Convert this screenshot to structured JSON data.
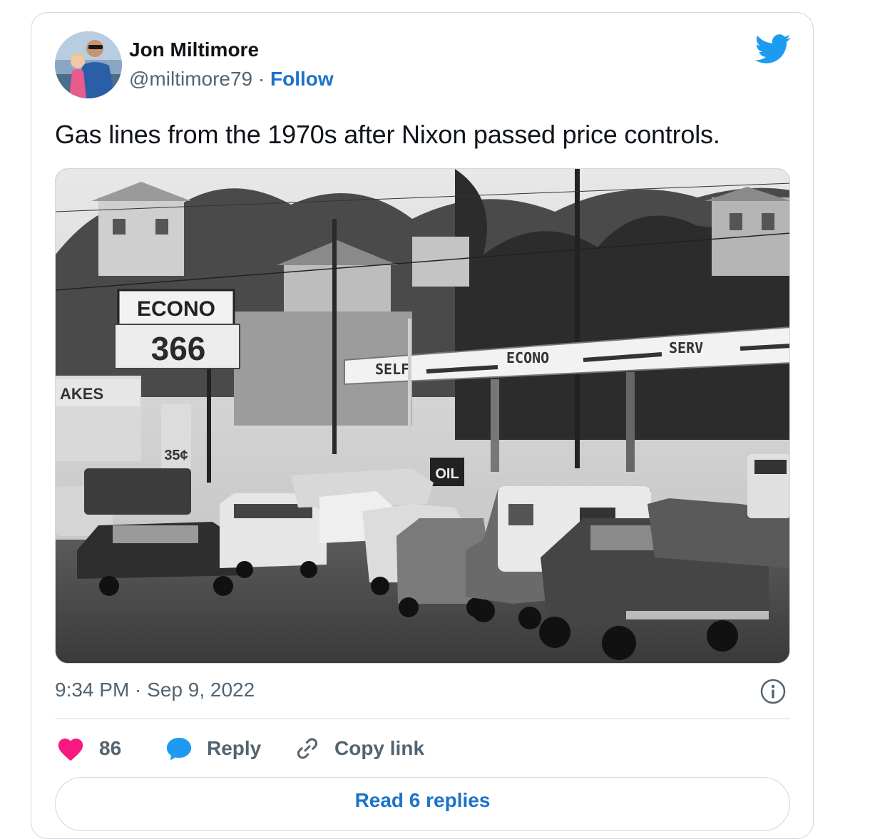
{
  "author": {
    "name": "Jon Miltimore",
    "handle": "@miltimore79",
    "separator": "·",
    "follow_label": "Follow"
  },
  "tweet": {
    "text": "Gas lines from the 1970s after Nixon passed price controls.",
    "timestamp": "9:34 PM · Sep 9, 2022"
  },
  "photo": {
    "sign_brand": "ECONO",
    "sign_price": "366",
    "sign_small_price": "35¢",
    "side_sign": "AKES",
    "oil_sign": "OIL",
    "canopy_text": [
      "SELF",
      "ECONO",
      "SERV"
    ]
  },
  "actions": {
    "likes_count": "86",
    "reply_label": "Reply",
    "copy_link_label": "Copy link",
    "read_replies_label": "Read 6 replies"
  },
  "colors": {
    "link_blue": "#1d72c9",
    "twitter_blue": "#1d9bf0",
    "like_pink": "#f91880",
    "muted_text": "#536471",
    "border": "#cfd9de"
  },
  "icons": {
    "logo": "twitter-bird-icon",
    "info": "info-icon",
    "like": "heart-icon",
    "reply": "speech-bubble-icon",
    "copy": "link-icon"
  }
}
